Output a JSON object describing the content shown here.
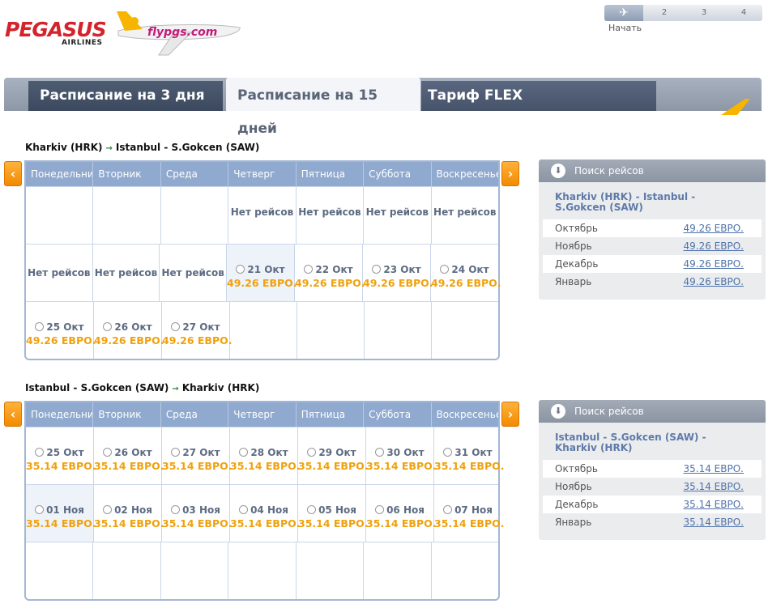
{
  "header": {
    "brand": "PEGASUS",
    "brand_sub": "AIRLINES",
    "url": "flypgs.com",
    "steps": [
      "✈",
      "2",
      "3",
      "4"
    ],
    "start_label": "Начать"
  },
  "tabs": [
    {
      "label": "Расписание на 3 дня"
    },
    {
      "label": "Расписание на 15 дней"
    },
    {
      "label": "Тариф FLEX"
    }
  ],
  "weekdays": [
    "Понедельник",
    "Вторник",
    "Среда",
    "Четверг",
    "Пятница",
    "Суббота",
    "Воскресенье"
  ],
  "nav": {
    "prev": "‹",
    "next": "›"
  },
  "outbound": {
    "from": "Kharkiv (HRK)",
    "to": "Istanbul - S.Gokcen (SAW)",
    "no_flights": "Нет рейсов",
    "rows": [
      [
        null,
        null,
        null,
        "none",
        "none",
        "none",
        "none"
      ],
      [
        "none",
        "none",
        "none",
        {
          "date": "21 Окт",
          "price": "49.26 ЕВРО."
        },
        {
          "date": "22 Окт",
          "price": "49.26 ЕВРО."
        },
        {
          "date": "23 Окт",
          "price": "49.26 ЕВРО."
        },
        {
          "date": "24 Окт",
          "price": "49.26 ЕВРО."
        }
      ],
      [
        {
          "date": "25 Окт",
          "price": "49.26 ЕВРО."
        },
        {
          "date": "26 Окт",
          "price": "49.26 ЕВРО."
        },
        {
          "date": "27 Окт",
          "price": "49.26 ЕВРО."
        },
        null,
        null,
        null,
        null
      ]
    ],
    "panel": {
      "title": "Поиск рейсов",
      "route": "Kharkiv (HRK) - Istanbul - S.Gokcen (SAW)",
      "months": [
        {
          "month": "Октябрь",
          "price": "49.26 ЕВРО."
        },
        {
          "month": "Ноябрь",
          "price": "49.26 ЕВРО."
        },
        {
          "month": "Декабрь",
          "price": "49.26 ЕВРО."
        },
        {
          "month": "Январь",
          "price": "49.26 ЕВРО."
        }
      ]
    }
  },
  "inbound": {
    "from": "Istanbul - S.Gokcen (SAW)",
    "to": "Kharkiv (HRK)",
    "rows": [
      [
        {
          "date": "25 Окт",
          "price": "35.14 ЕВРО."
        },
        {
          "date": "26 Окт",
          "price": "35.14 ЕВРО."
        },
        {
          "date": "27 Окт",
          "price": "35.14 ЕВРО."
        },
        {
          "date": "28 Окт",
          "price": "35.14 ЕВРО."
        },
        {
          "date": "29 Окт",
          "price": "35.14 ЕВРО."
        },
        {
          "date": "30 Окт",
          "price": "35.14 ЕВРО."
        },
        {
          "date": "31 Окт",
          "price": "35.14 ЕВРО."
        }
      ],
      [
        {
          "date": "01 Ноя",
          "price": "35.14 ЕВРО."
        },
        {
          "date": "02 Ноя",
          "price": "35.14 ЕВРО."
        },
        {
          "date": "03 Ноя",
          "price": "35.14 ЕВРО."
        },
        {
          "date": "04 Ноя",
          "price": "35.14 ЕВРО."
        },
        {
          "date": "05 Ноя",
          "price": "35.14 ЕВРО."
        },
        {
          "date": "06 Ноя",
          "price": "35.14 ЕВРО."
        },
        {
          "date": "07 Ноя",
          "price": "35.14 ЕВРО."
        }
      ],
      [
        null,
        null,
        null,
        null,
        null,
        null,
        null
      ]
    ],
    "panel": {
      "title": "Поиск рейсов",
      "route": "Istanbul - S.Gokcen (SAW) - Kharkiv (HRK)",
      "months": [
        {
          "month": "Октябрь",
          "price": "35.14 ЕВРО."
        },
        {
          "month": "Ноябрь",
          "price": "35.14 ЕВРО."
        },
        {
          "month": "Декабрь",
          "price": "35.14 ЕВРО."
        },
        {
          "month": "Январь",
          "price": "35.14 ЕВРО."
        }
      ]
    }
  },
  "colors": {
    "accent": "#f0a10d",
    "header_blue": "#8fa9cf",
    "brand_red": "#d4232b"
  }
}
